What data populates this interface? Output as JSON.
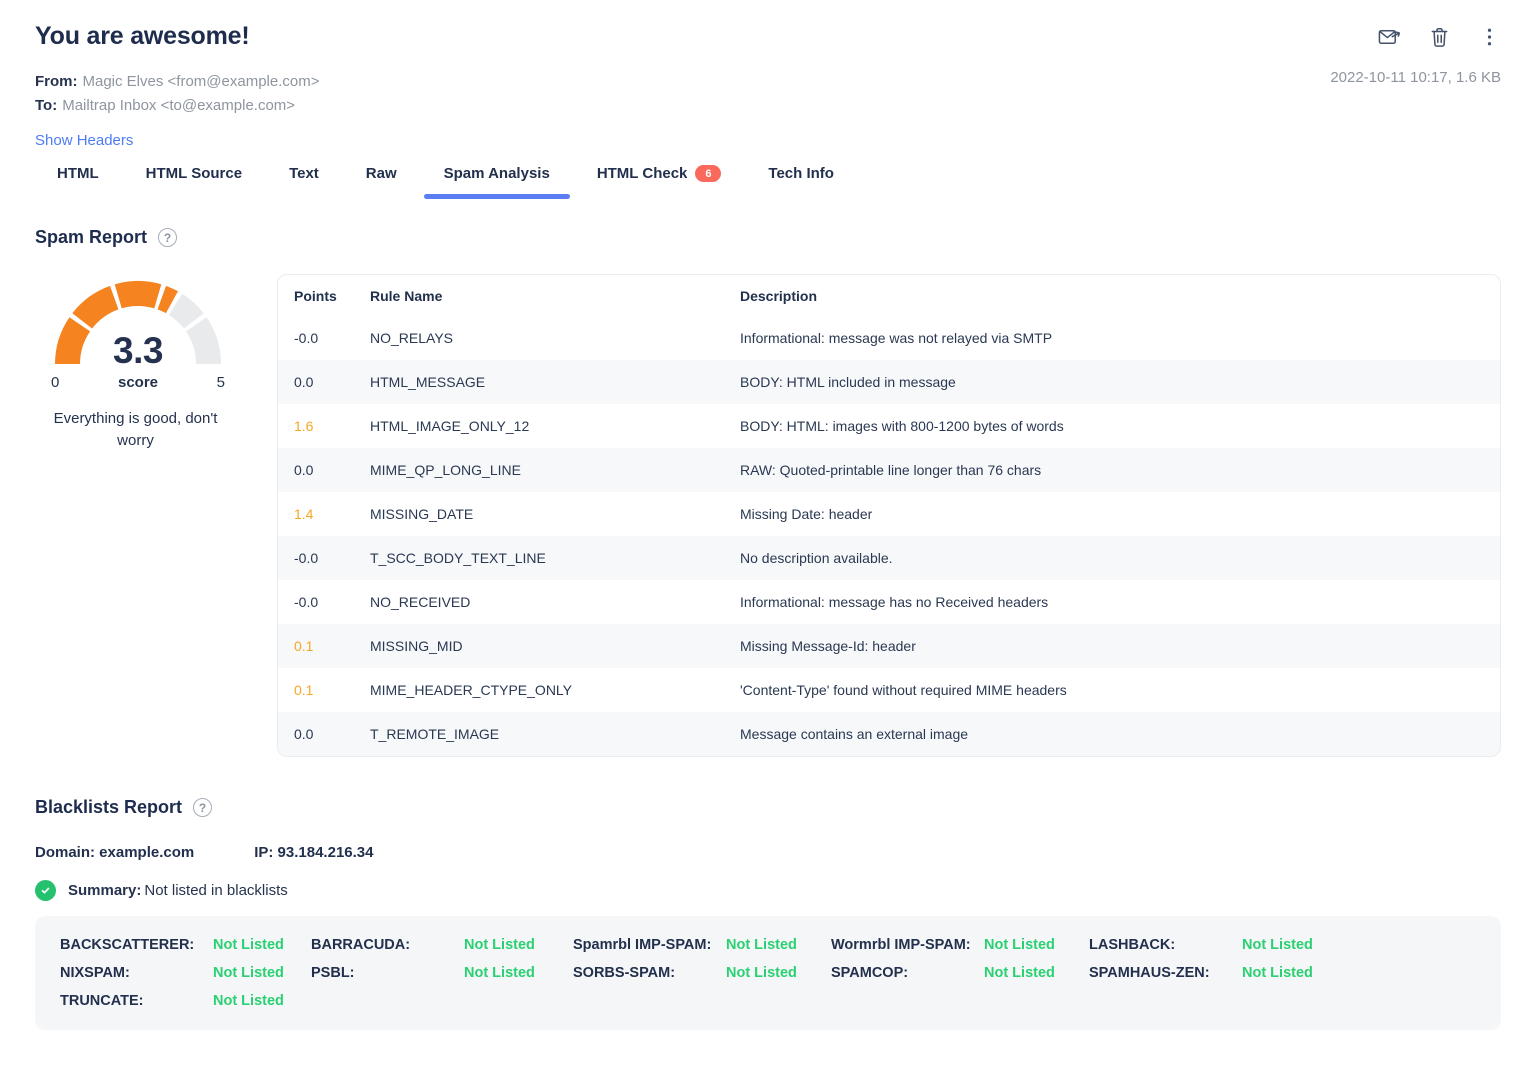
{
  "header": {
    "title": "You are awesome!",
    "from_label": "From:",
    "from_value": "Magic Elves <from@example.com>",
    "to_label": "To:",
    "to_value": "Mailtrap Inbox <to@example.com>",
    "show_headers_link": "Show Headers",
    "meta": "2022-10-11 10:17, 1.6 KB"
  },
  "icons": {
    "help_glyph": "?"
  },
  "tabs": [
    {
      "label": "HTML"
    },
    {
      "label": "HTML Source"
    },
    {
      "label": "Text"
    },
    {
      "label": "Raw"
    },
    {
      "label": "Spam Analysis",
      "active": true
    },
    {
      "label": "HTML Check",
      "badge": "6"
    },
    {
      "label": "Tech Info"
    }
  ],
  "spam_report": {
    "heading": "Spam Report",
    "gauge": {
      "type": "gauge",
      "score": "3.3",
      "score_value": 3.3,
      "min": 0,
      "max": 5,
      "min_label": "0",
      "max_label": "5",
      "score_label": "score",
      "message": "Everything is good, don't worry",
      "segments": 5,
      "color_filled": "#F5831F",
      "color_empty": "#E9EAEC"
    },
    "table": {
      "columns": [
        "Points",
        "Rule Name",
        "Description"
      ],
      "rows": [
        {
          "points": "-0.0",
          "rule": "NO_RELAYS",
          "desc": "Informational: message was not relayed via SMTP",
          "highlight": false
        },
        {
          "points": "0.0",
          "rule": "HTML_MESSAGE",
          "desc": "BODY: HTML included in message",
          "highlight": false
        },
        {
          "points": "1.6",
          "rule": "HTML_IMAGE_ONLY_12",
          "desc": "BODY: HTML: images with 800-1200 bytes of words",
          "highlight": true
        },
        {
          "points": "0.0",
          "rule": "MIME_QP_LONG_LINE",
          "desc": "RAW: Quoted-printable line longer than 76 chars",
          "highlight": false
        },
        {
          "points": "1.4",
          "rule": "MISSING_DATE",
          "desc": "Missing Date: header",
          "highlight": true
        },
        {
          "points": "-0.0",
          "rule": "T_SCC_BODY_TEXT_LINE",
          "desc": "No description available.",
          "highlight": false
        },
        {
          "points": "-0.0",
          "rule": "NO_RECEIVED",
          "desc": "Informational: message has no Received headers",
          "highlight": false
        },
        {
          "points": "0.1",
          "rule": "MISSING_MID",
          "desc": "Missing Message-Id: header",
          "highlight": true
        },
        {
          "points": "0.1",
          "rule": "MIME_HEADER_CTYPE_ONLY",
          "desc": "'Content-Type' found without required MIME headers",
          "highlight": true
        },
        {
          "points": "0.0",
          "rule": "T_REMOTE_IMAGE",
          "desc": "Message contains an external image",
          "highlight": false
        }
      ]
    }
  },
  "blacklists": {
    "heading": "Blacklists Report",
    "domain": "Domain: example.com",
    "ip": "IP: 93.184.216.34",
    "summary_label": "Summary:",
    "summary_value": "Not listed in blacklists",
    "entries": [
      {
        "name": "BACKSCATTERER:",
        "status": "Not Listed"
      },
      {
        "name": "BARRACUDA:",
        "status": "Not Listed"
      },
      {
        "name": "Spamrbl IMP-SPAM:",
        "status": "Not Listed"
      },
      {
        "name": "Wormrbl IMP-SPAM:",
        "status": "Not Listed"
      },
      {
        "name": "LASHBACK:",
        "status": "Not Listed"
      },
      {
        "name": "NIXSPAM:",
        "status": "Not Listed"
      },
      {
        "name": "PSBL:",
        "status": "Not Listed"
      },
      {
        "name": "SORBS-SPAM:",
        "status": "Not Listed"
      },
      {
        "name": "SPAMCOP:",
        "status": "Not Listed"
      },
      {
        "name": "SPAMHAUS-ZEN:",
        "status": "Not Listed"
      },
      {
        "name": "TRUNCATE:",
        "status": "Not Listed"
      }
    ]
  },
  "colors": {
    "accent_blue": "#5b7ef5",
    "orange": "#F5831F",
    "points_orange": "#F6A623",
    "badge_red": "#FA6A5C",
    "green": "#2AD072"
  }
}
